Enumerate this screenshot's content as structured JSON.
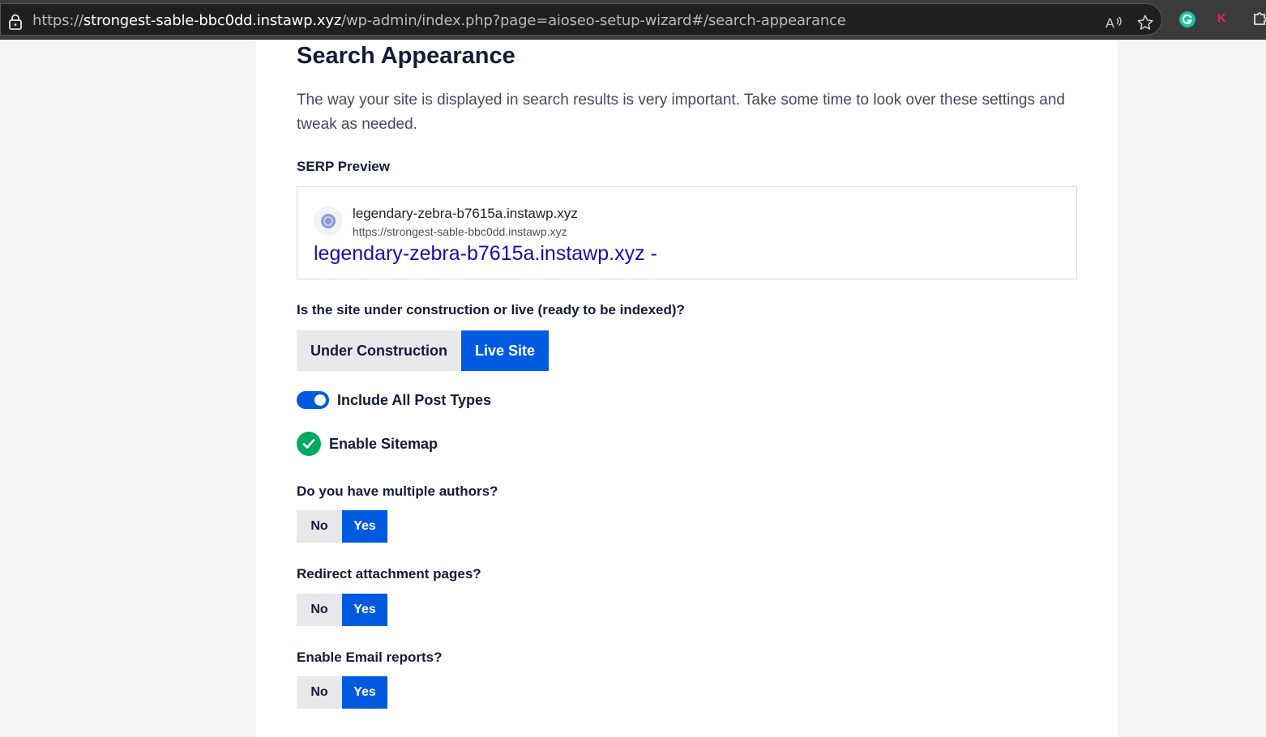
{
  "browser": {
    "url_prefix": "https://",
    "url_host": "strongest-sable-bbc0dd.instawp.xyz",
    "url_path": "/wp-admin/index.php?page=aioseo-setup-wizard#/search-appearance",
    "extension_k": "K"
  },
  "page": {
    "title": "Search Appearance",
    "description": "The way your site is displayed in search results is very important. Take some time to look over these settings and tweak as needed."
  },
  "serp": {
    "label": "SERP Preview",
    "site_name": "legendary-zebra-b7615a.instawp.xyz",
    "site_url": "https://strongest-sable-bbc0dd.instawp.xyz",
    "result_title": "legendary-zebra-b7615a.instawp.xyz -"
  },
  "site_status": {
    "question": "Is the site under construction or live (ready to be indexed)?",
    "options": [
      "Under Construction",
      "Live Site"
    ],
    "selected": "Live Site"
  },
  "post_types": {
    "label": "Include All Post Types",
    "enabled": true
  },
  "sitemap": {
    "label": "Enable Sitemap",
    "enabled": true
  },
  "multiple_authors": {
    "question": "Do you have multiple authors?",
    "no": "No",
    "yes": "Yes",
    "selected": "Yes"
  },
  "redirect_attachments": {
    "question": "Redirect attachment pages?",
    "no": "No",
    "yes": "Yes",
    "selected": "Yes"
  },
  "email_reports": {
    "question": "Enable Email reports?",
    "no": "No",
    "yes": "Yes",
    "selected": "Yes"
  },
  "colors": {
    "accent": "#005ae0",
    "success": "#00aa63",
    "link": "#1a0dab"
  }
}
